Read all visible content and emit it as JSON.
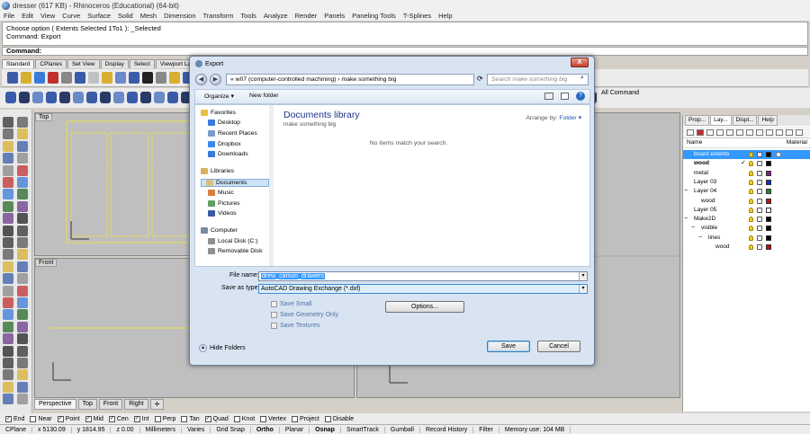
{
  "window": {
    "title": "dresser (617 KB) - Rhinoceros (Educational) (64-bit)"
  },
  "menu": [
    "File",
    "Edit",
    "View",
    "Curve",
    "Surface",
    "Solid",
    "Mesh",
    "Dimension",
    "Transform",
    "Tools",
    "Analyze",
    "Render",
    "Panels",
    "Paneling Tools",
    "T-Splines",
    "Help"
  ],
  "command_history": [
    "Choose option ( Extents  Selected  1To1 ): _Selected",
    "Command: Export"
  ],
  "command_prompt": "Command:",
  "toolbar_tabs": [
    "Standard",
    "CPlanes",
    "Set View",
    "Display",
    "Select",
    "Viewport Layout"
  ],
  "all_commands_label": "All Command",
  "viewports": {
    "top_label": "Top",
    "front_label": "Front"
  },
  "viewport_tabs": [
    "Perspective",
    "Top",
    "Front",
    "Right"
  ],
  "osnap": [
    {
      "label": "End",
      "checked": true
    },
    {
      "label": "Near",
      "checked": false
    },
    {
      "label": "Point",
      "checked": true
    },
    {
      "label": "Mid",
      "checked": true
    },
    {
      "label": "Cen",
      "checked": true
    },
    {
      "label": "Int",
      "checked": true
    },
    {
      "label": "Perp",
      "checked": false
    },
    {
      "label": "Tan",
      "checked": false
    },
    {
      "label": "Quad",
      "checked": true
    },
    {
      "label": "Knot",
      "checked": false
    },
    {
      "label": "Vertex",
      "checked": false
    },
    {
      "label": "Project",
      "checked": false
    },
    {
      "label": "Disable",
      "checked": false
    }
  ],
  "status": {
    "cplane": "CPlane",
    "x": "x 5130.09",
    "y": "y 1814.95",
    "z": "z 0.00",
    "units": "Millimeters",
    "layer": "Varies",
    "grid_snap": "Grid Snap",
    "ortho": "Ortho",
    "planar": "Planar",
    "osnap": "Osnap",
    "smarttrack": "SmartTrack",
    "gumball": "Gumball",
    "record_history": "Record History",
    "filter": "Filter",
    "memory": "Memory use: 104 MB"
  },
  "layers_panel": {
    "tabs": [
      "Prop...",
      "Lay...",
      "Displ...",
      "Help"
    ],
    "col_name": "Name",
    "col_material": "Material",
    "rows": [
      {
        "name": "board extents",
        "indent": 0,
        "selected": true,
        "color": "#000000"
      },
      {
        "name": "wood",
        "indent": 0,
        "current": true,
        "color": "#000000"
      },
      {
        "name": "metal",
        "indent": 0,
        "color": "#8a1a8a"
      },
      {
        "name": "Layer 03",
        "indent": 0,
        "color": "#1030c0"
      },
      {
        "name": "Layer 04",
        "indent": 0,
        "expand": "−",
        "color": "#1a8a2a"
      },
      {
        "name": "wood",
        "indent": 1,
        "color": "#c01010"
      },
      {
        "name": "Layer 05",
        "indent": 0,
        "color": "#ffffff"
      },
      {
        "name": "Make2D",
        "indent": 0,
        "expand": "−",
        "color": "#000000"
      },
      {
        "name": "visible",
        "indent": 1,
        "expand": "−",
        "color": "#000000"
      },
      {
        "name": "lines",
        "indent": 2,
        "expand": "−",
        "color": "#000000"
      },
      {
        "name": "wood",
        "indent": 3,
        "color": "#c01010"
      }
    ]
  },
  "dialog": {
    "title": "Export",
    "close": "X",
    "address": "«  w07 (computer-controlled machining)  ›  make something big",
    "search_placeholder": "Search make something big",
    "organize": "Organize ▾",
    "new_folder": "New folder",
    "nav": [
      {
        "label": "Favorites",
        "group": true
      },
      {
        "label": "Desktop"
      },
      {
        "label": "Recent Places"
      },
      {
        "label": "Dropbox"
      },
      {
        "label": "Downloads"
      },
      {
        "label": "Libraries",
        "group": true
      },
      {
        "label": "Documents",
        "selected": true
      },
      {
        "label": "Music"
      },
      {
        "label": "Pictures"
      },
      {
        "label": "Videos"
      },
      {
        "label": "Computer",
        "group": true
      },
      {
        "label": "Local Disk (C:)"
      },
      {
        "label": "Removable Disk"
      }
    ],
    "library_title": "Documents library",
    "library_sub": "make something big",
    "arrange_label": "Arrange by:",
    "arrange_value": "Folder ▾",
    "empty_message": "No items match your search.",
    "file_name_label": "File name:",
    "file_name_value": "drew_carson_drawers",
    "save_type_label": "Save as type:",
    "save_type_value": "AutoCAD Drawing Exchange (*.dxf)",
    "options": [
      "Save Small",
      "Save Geometry Only",
      "Save Textures"
    ],
    "options_button": "Options...",
    "save_button": "Save",
    "cancel_button": "Cancel",
    "hide_folders": "Hide Folders"
  }
}
